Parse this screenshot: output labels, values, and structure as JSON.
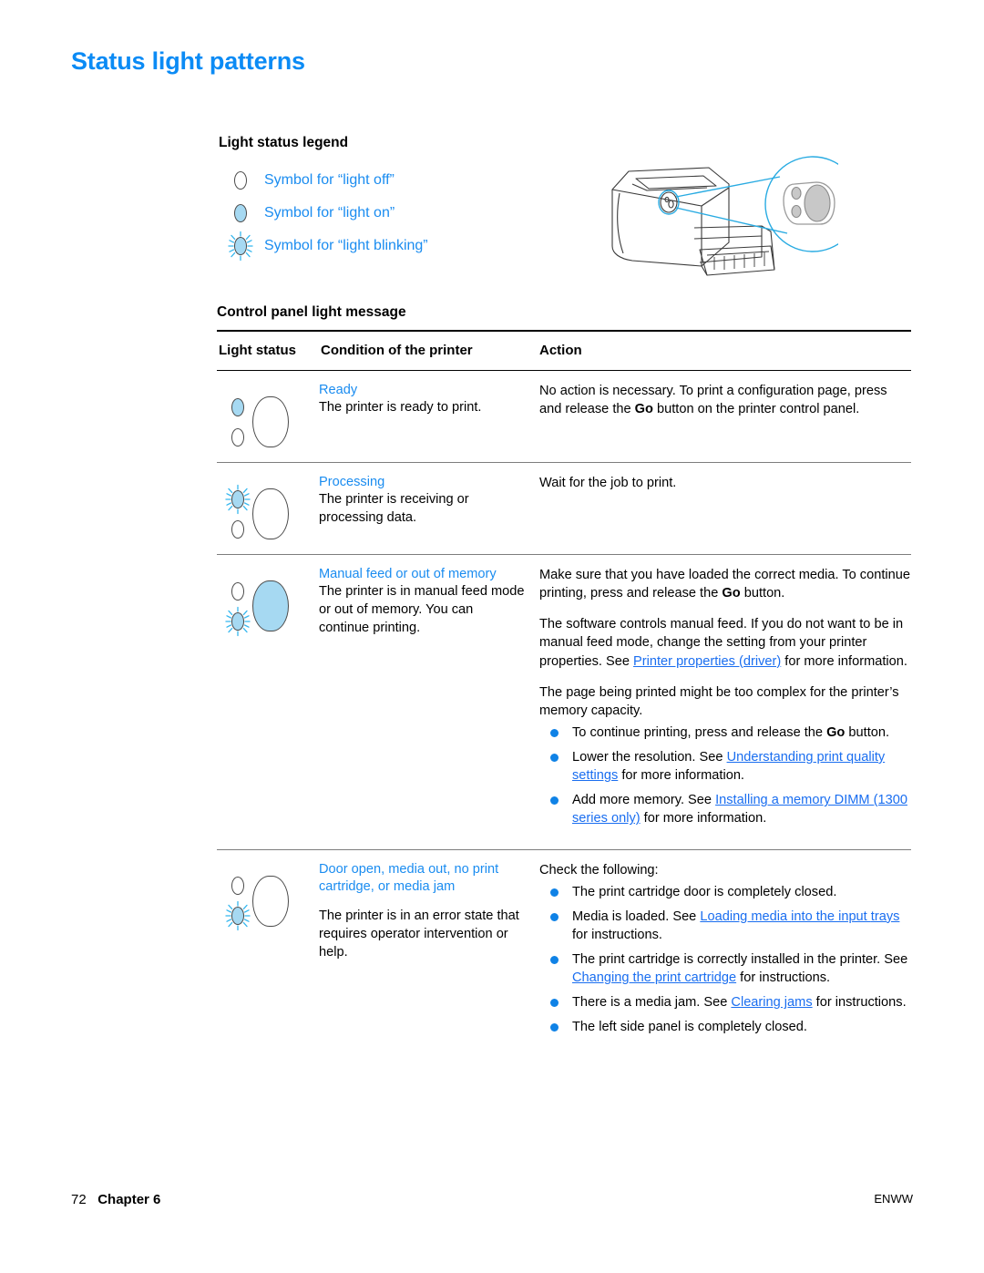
{
  "page": {
    "title": "Status light patterns"
  },
  "legend": {
    "heading": "Light status legend",
    "items": [
      {
        "symbol": "light-off-icon",
        "label": "Symbol for “light off”"
      },
      {
        "symbol": "light-on-icon",
        "label": "Symbol for “light on”"
      },
      {
        "symbol": "light-blinking-icon",
        "label": "Symbol for “light blinking”"
      }
    ]
  },
  "illustration": {
    "name": "printer-control-panel-illustration",
    "callout": "magnified control panel with two status lights and Go button"
  },
  "table": {
    "caption": "Control panel light message",
    "headers": {
      "light_status": "Light status",
      "condition": "Condition of the printer",
      "action": "Action"
    },
    "rows": [
      {
        "lights": {
          "top": "on",
          "bottom": "off",
          "go": "off"
        },
        "condition_title": "Ready",
        "condition_body": "The printer is ready to print.",
        "action_paragraphs": [
          "No action is necessary. To print a configuration page, press and release the Go button on the printer control panel."
        ]
      },
      {
        "lights": {
          "top": "blinking",
          "bottom": "off",
          "go": "off"
        },
        "condition_title": "Processing",
        "condition_body": "The printer is receiving or processing data.",
        "action_paragraphs": [
          "Wait for the job to print."
        ]
      },
      {
        "lights": {
          "top": "off",
          "bottom": "blinking",
          "go": "on"
        },
        "condition_title": "Manual feed or out of memory",
        "condition_body": "The printer is in manual feed mode or out of memory. You can continue printing.",
        "action_paragraphs": [
          "Make sure that you have loaded the correct media. To continue printing, press and release the Go button.",
          "The software controls manual feed. If you do not want to be in manual feed mode, change the setting from your printer properties. See Printer properties (driver) for more information.",
          "The page being printed might be too complex for the printer’s memory capacity."
        ],
        "action_bullets": [
          "To continue printing, press and release the Go button.",
          "Lower the resolution. See Understanding print quality settings for more information.",
          "Add more memory. See Installing a memory DIMM (1300 series only) for more information."
        ]
      },
      {
        "lights": {
          "top": "off",
          "bottom": "blinking",
          "go": "off"
        },
        "condition_title": "Door open, media out, no print cartridge, or media jam",
        "condition_body": "The printer is in an error state that requires operator intervention or help.",
        "action_paragraphs": [
          "Check the following:"
        ],
        "action_bullets": [
          "The print cartridge door is completely closed.",
          "Media is loaded. See Loading media into the input trays for instructions.",
          "The print cartridge is correctly installed in the printer. See Changing the print cartridge for instructions.",
          "There is a media jam. See Clearing jams for instructions.",
          "The left side panel is completely closed."
        ]
      }
    ]
  },
  "links": {
    "printer_properties": "Printer properties (driver)",
    "print_quality_a": "Understanding print quality ",
    "print_quality_b": "settings",
    "memory_dimm_a": "Installing a memory DIMM ",
    "memory_dimm_b": "(1300 series only)",
    "loading_media_a": "Loading media into the input ",
    "loading_media_b": "trays",
    "changing_cartridge": "Changing the print cartridge",
    "clearing_jams": "Clearing jams"
  },
  "fragments": {
    "r1_a": "No action is necessary. To print a configuration page, press and release the ",
    "r1_go": "Go",
    "r1_b": " button on the printer control panel.",
    "r3_a": "Make sure that you have loaded the correct media. To continue printing, press and release the ",
    "r3_go": "Go",
    "r3_b": " button.",
    "r3_p2_a": "The software controls manual feed. If you do not want to be in manual feed mode, change the setting from your printer properties. See ",
    "r3_p2_b": " for more information.",
    "r3_p3": "The page being printed might be too complex for the printer’s memory capacity.",
    "r3_b1_a": "To continue printing, press and release the ",
    "r3_b1_go": "Go",
    "r3_b1_b": " button.",
    "r3_b2_a": "Lower the resolution. See ",
    "r3_b2_b": " for more information.",
    "r3_b3_a": "Add more memory. See ",
    "r3_b3_b": " for more information.",
    "r4_head": "Check the following:",
    "r4_b1": "The print cartridge door is completely closed.",
    "r4_b2_a": "Media is loaded. See ",
    "r4_b2_b": " for instructions.",
    "r4_b3_a": "The print cartridge is correctly installed in the printer. See ",
    "r4_b3_b": " for instructions.",
    "r4_b4_a": "There is a media jam. See ",
    "r4_b4_b": " for instructions.",
    "r4_b5": "The left side panel is completely closed."
  },
  "footer": {
    "page_number": "72",
    "chapter": "Chapter 6",
    "locale": "ENWW"
  },
  "colors": {
    "title_blue": "#0b8bf5",
    "link_blue": "#1a6ef0",
    "caption_blue": "#1a8cf0",
    "bullet_blue": "#0f82e6",
    "light_on_fill": "#a6d9f2",
    "callout_cyan": "#29abe2"
  }
}
